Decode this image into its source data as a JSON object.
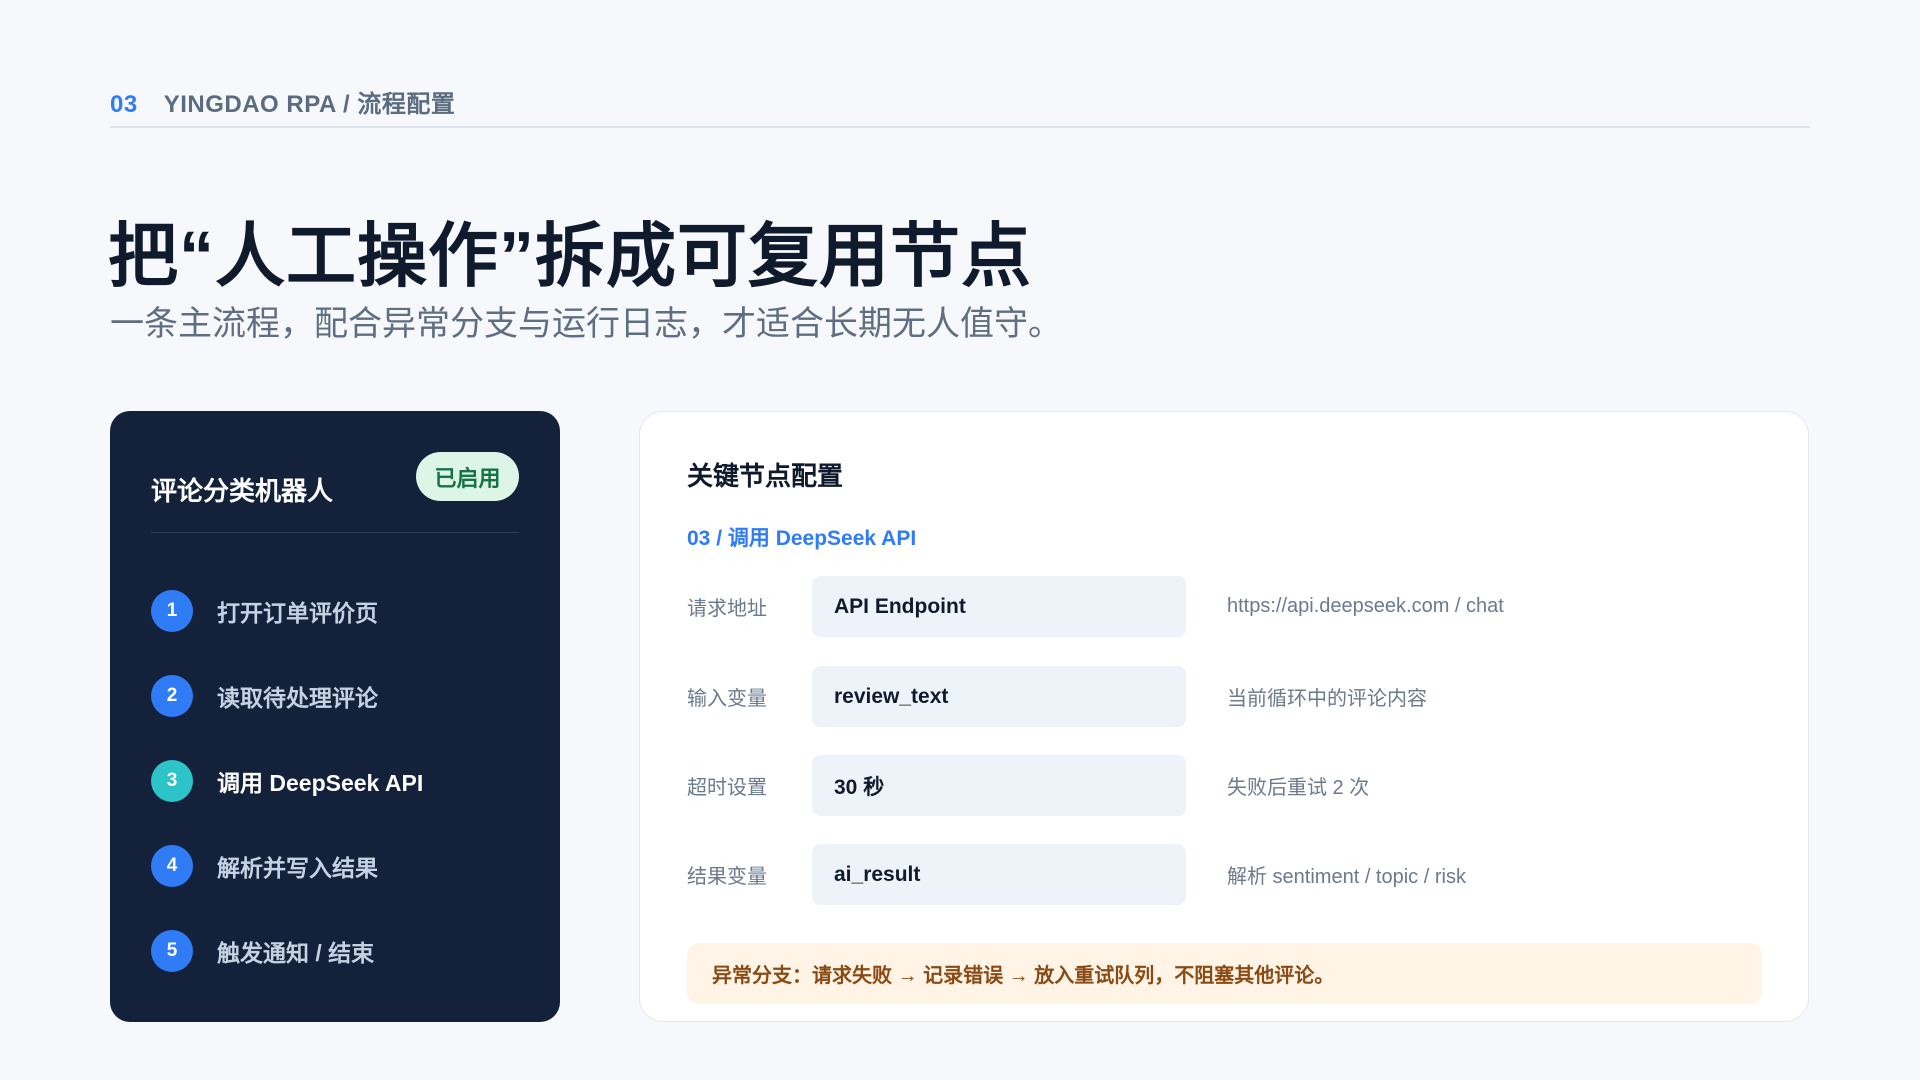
{
  "header": {
    "section_number": "03",
    "breadcrumb": "YINGDAO RPA / 流程配置"
  },
  "title": "把“人工操作”拆成可复用节点",
  "subtitle": "一条主流程，配合异常分支与运行日志，才适合长期无人值守。",
  "workflow_card": {
    "title": "评论分类机器人",
    "status": "已启用",
    "steps": [
      {
        "number": "1",
        "label": "打开订单评价页",
        "active": false
      },
      {
        "number": "2",
        "label": "读取待处理评论",
        "active": false
      },
      {
        "number": "3",
        "label": "调用 DeepSeek API",
        "active": true
      },
      {
        "number": "4",
        "label": "解析并写入结果",
        "active": false
      },
      {
        "number": "5",
        "label": "触发通知 / 结束",
        "active": false
      }
    ]
  },
  "config_panel": {
    "title": "关键节点配置",
    "node": "03 / 调用 DeepSeek API",
    "rows": [
      {
        "label": "请求地址",
        "value": "API Endpoint",
        "note": "https://api.deepseek.com / chat"
      },
      {
        "label": "输入变量",
        "value": "review_text",
        "note": "当前循环中的评论内容"
      },
      {
        "label": "超时设置",
        "value": "30 秒",
        "note": "失败后重试 2 次"
      },
      {
        "label": "结果变量",
        "value": "ai_result",
        "note": "解析 sentiment / topic / risk"
      }
    ],
    "exception_note": "异常分支：请求失败 → 记录错误 → 放入重试队列，不阻塞其他评论。"
  },
  "colors": {
    "accent": "#2f7cf6",
    "active_step": "#2cc3c9",
    "card_dark": "#13213a",
    "status_badge_bg": "#dcf5e7",
    "status_badge_text": "#177245",
    "alert_bg": "#fff4e6",
    "alert_text": "#8a4a14"
  }
}
